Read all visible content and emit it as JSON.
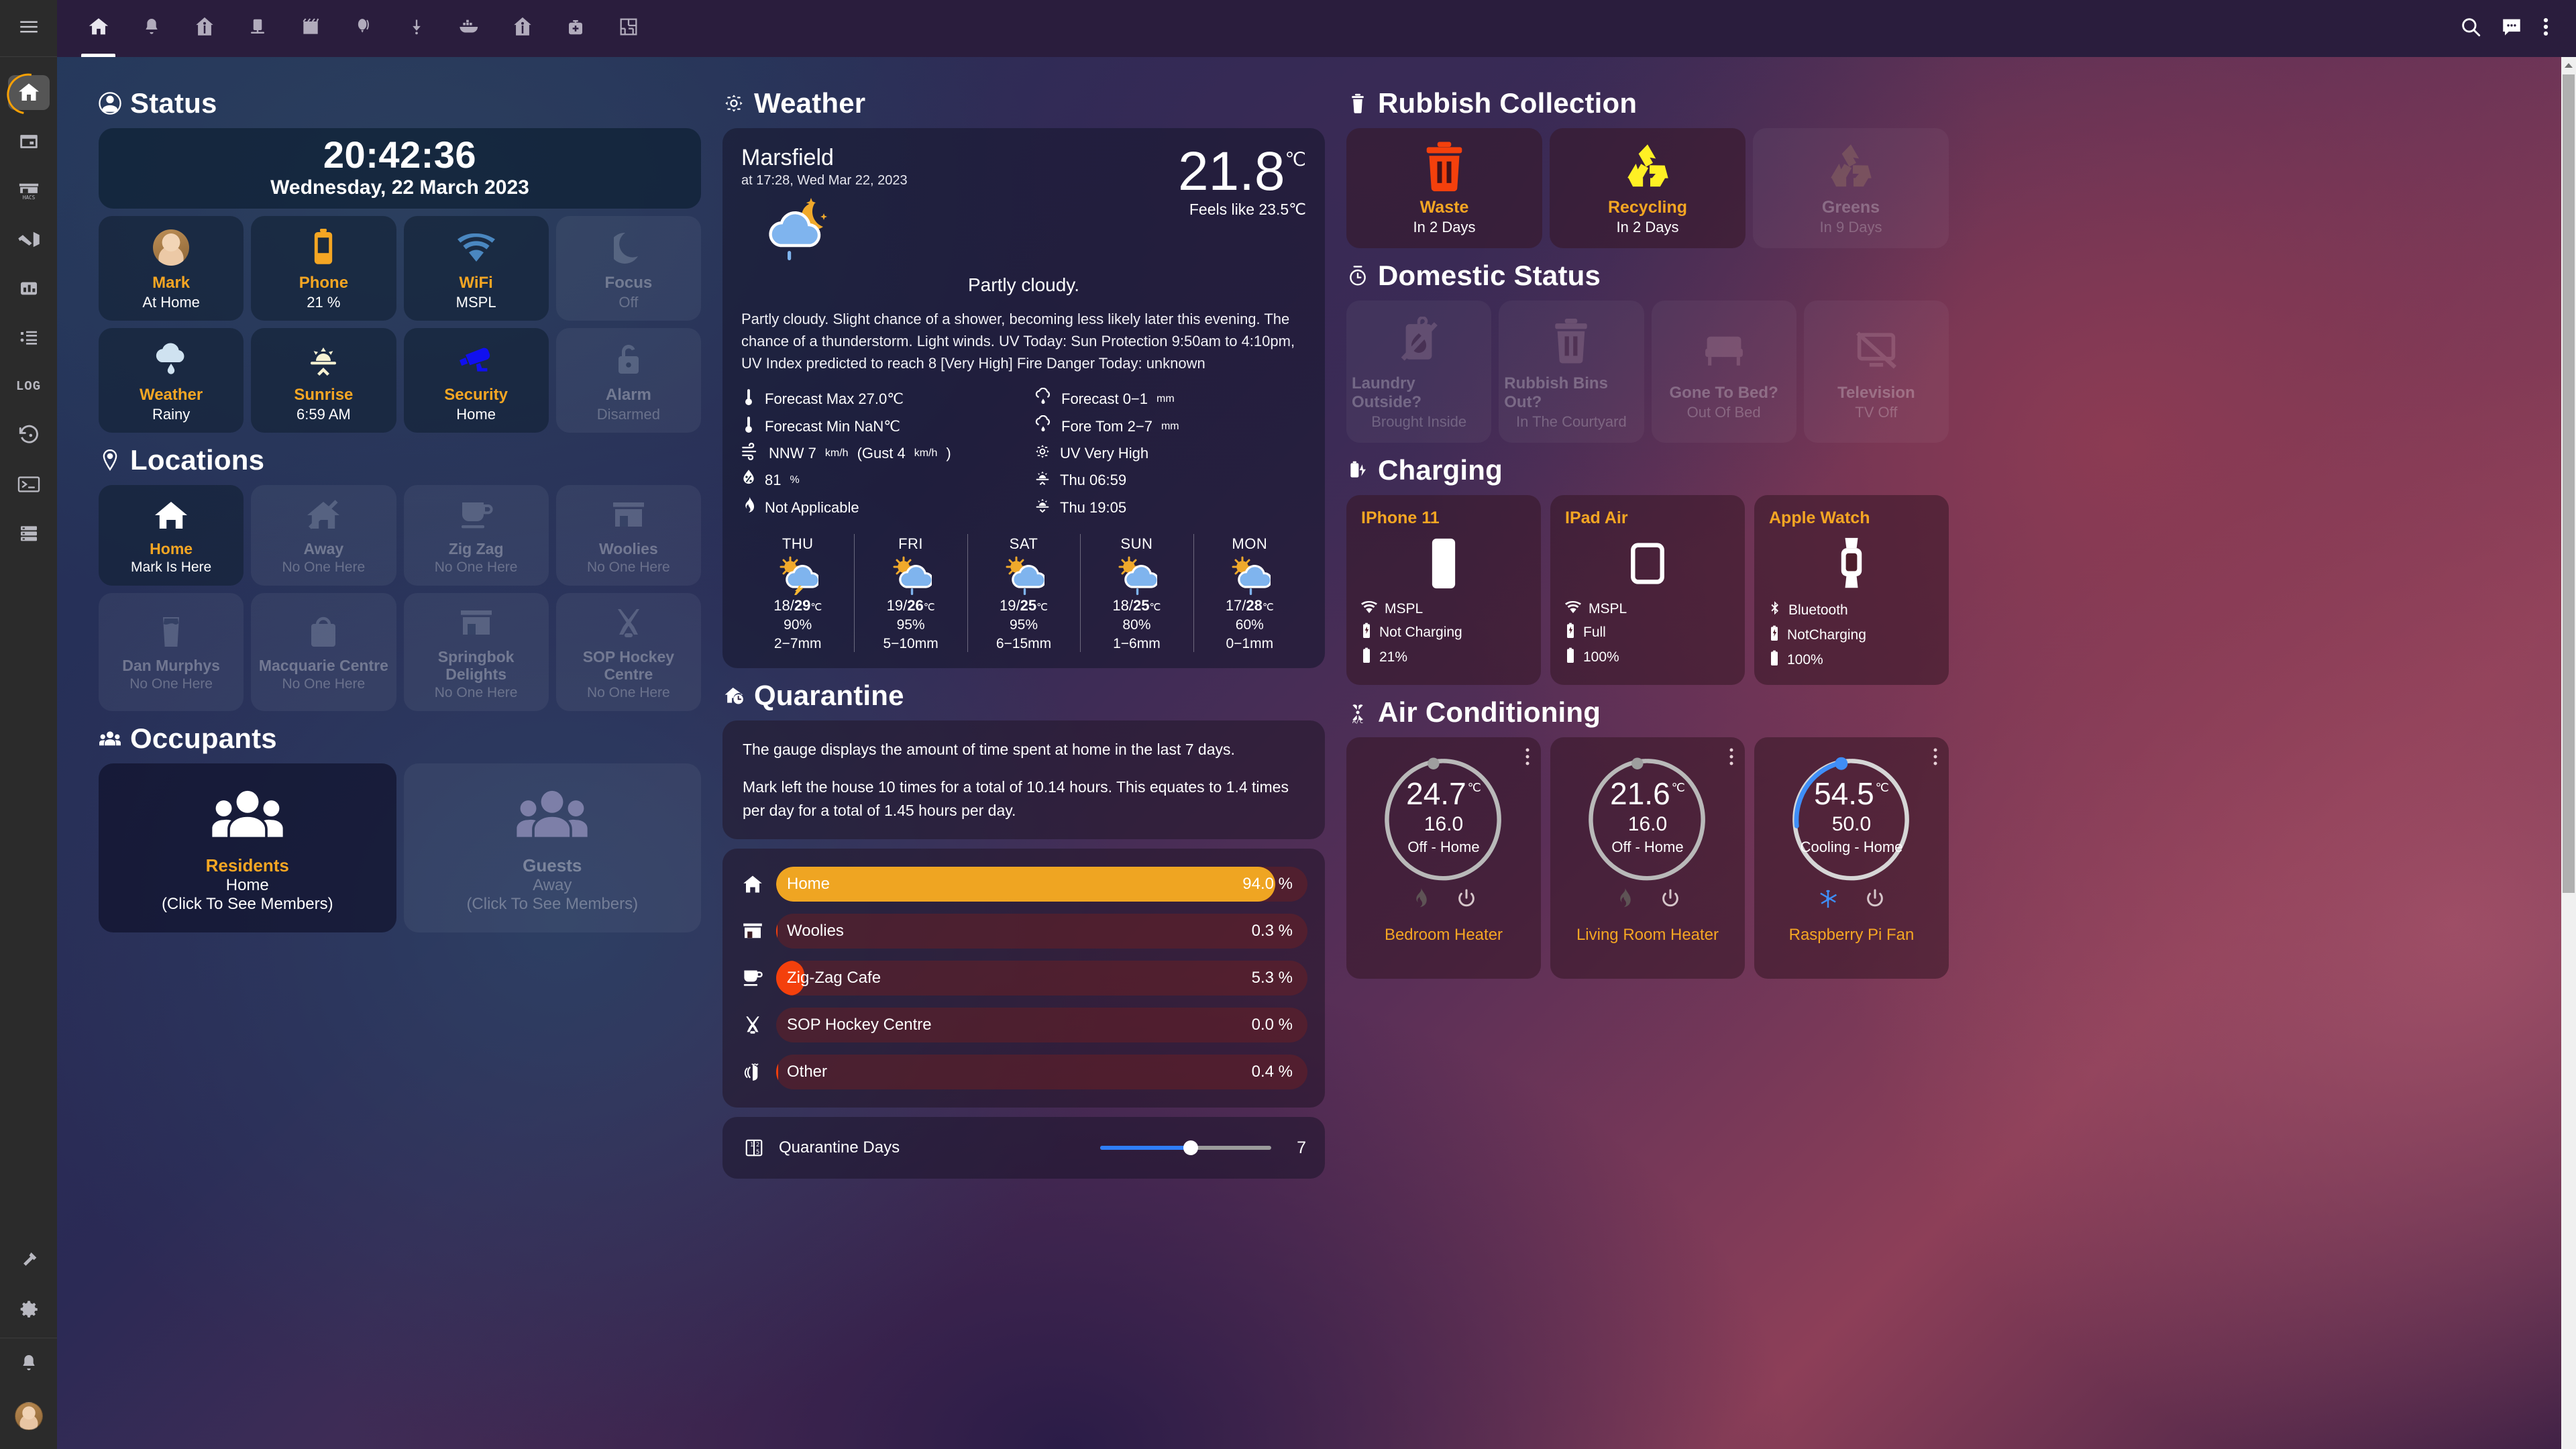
{
  "sidebar": {
    "menu_icon": "hamburger-icon",
    "items": [
      {
        "name": "home",
        "icon": "home-icon",
        "active": true
      },
      {
        "name": "calendar",
        "icon": "calendar-icon",
        "active": false
      },
      {
        "name": "hacs",
        "icon": "hacs-store-icon",
        "label": "HACS",
        "active": false
      },
      {
        "name": "vscode",
        "icon": "vscode-icon",
        "active": false
      },
      {
        "name": "statistics",
        "icon": "bar-chart-icon",
        "active": false
      },
      {
        "name": "list",
        "icon": "list-icon",
        "active": false
      },
      {
        "name": "log",
        "icon": "log-text-icon",
        "label": "LOG",
        "active": false
      },
      {
        "name": "history",
        "icon": "history-restore-icon",
        "active": false
      },
      {
        "name": "terminal",
        "icon": "terminal-icon",
        "active": false
      },
      {
        "name": "server",
        "icon": "server-rack-icon",
        "active": false
      }
    ],
    "bottom_items": [
      {
        "name": "developer-tools",
        "icon": "hammer-icon"
      },
      {
        "name": "settings",
        "icon": "gear-icon"
      },
      {
        "name": "notifications",
        "icon": "bell-icon"
      },
      {
        "name": "user-avatar",
        "icon": "avatar-icon"
      }
    ]
  },
  "topbar": {
    "tabs": [
      {
        "name": "home",
        "icon": "home-icon",
        "active": true
      },
      {
        "name": "alerts",
        "icon": "bell-icon",
        "active": false
      },
      {
        "name": "house-anchor",
        "icon": "home-anchor-icon",
        "active": false
      },
      {
        "name": "media",
        "icon": "media-player-icon",
        "active": false
      },
      {
        "name": "calendar-board",
        "icon": "notebook-icon",
        "active": false
      },
      {
        "name": "balloon",
        "icon": "balloon-icon",
        "active": false
      },
      {
        "name": "download",
        "icon": "download-icon",
        "active": false
      },
      {
        "name": "docker",
        "icon": "docker-icon",
        "active": false
      },
      {
        "name": "house-anchor-2",
        "icon": "home-anchor-icon",
        "active": false
      },
      {
        "name": "health",
        "icon": "medical-bag-icon",
        "active": false
      },
      {
        "name": "floorplan",
        "icon": "floorplan-icon",
        "active": false
      }
    ],
    "actions": [
      {
        "name": "search",
        "icon": "search-icon"
      },
      {
        "name": "assist",
        "icon": "chat-bubble-icon"
      },
      {
        "name": "overflow-menu",
        "icon": "dots-vertical-icon"
      }
    ]
  },
  "colors": {
    "accent": "#f5a623",
    "waste": "#f4400c",
    "recycling": "#fff024",
    "cooling": "#3f8ef7",
    "home_bar": "#efa522",
    "slider": "#2f7ef7"
  },
  "status": {
    "heading": "Status",
    "heading_icon": "account-icon",
    "clock": {
      "time": "20:42:36",
      "date": "Wednesday, 22 March 2023"
    },
    "tiles": [
      {
        "name": "Mark",
        "state": "At Home",
        "icon": "avatar-icon",
        "active": true
      },
      {
        "name": "Phone",
        "state": "21 %",
        "icon": "battery-icon",
        "active": true
      },
      {
        "name": "WiFi",
        "state": "MSPL",
        "icon": "wifi-icon",
        "active": true
      },
      {
        "name": "Focus",
        "state": "Off",
        "icon": "moon-icon",
        "active": false
      },
      {
        "name": "Weather",
        "state": "Rainy",
        "icon": "weather-rainy-icon",
        "active": true
      },
      {
        "name": "Sunrise",
        "state": "6:59 AM",
        "icon": "sunrise-icon",
        "active": true
      },
      {
        "name": "Security",
        "state": "Home",
        "icon": "cctv-icon",
        "active": true
      },
      {
        "name": "Alarm",
        "state": "Disarmed",
        "icon": "lock-open-icon",
        "active": false
      }
    ]
  },
  "locations": {
    "heading": "Locations",
    "heading_icon": "map-marker-icon",
    "tiles": [
      {
        "name": "Home",
        "state": "Mark Is Here",
        "icon": "home-icon",
        "active": true
      },
      {
        "name": "Away",
        "state": "No One Here",
        "icon": "home-off-icon",
        "active": false
      },
      {
        "name": "Zig Zag",
        "state": "No One Here",
        "icon": "coffee-cup-icon",
        "active": false
      },
      {
        "name": "Woolies",
        "state": "No One Here",
        "icon": "storefront-icon",
        "active": false
      },
      {
        "name": "Dan Murphys",
        "state": "No One Here",
        "icon": "glass-icon",
        "active": false
      },
      {
        "name": "Macquarie Centre",
        "state": "No One Here",
        "icon": "shopping-bag-icon",
        "active": false
      },
      {
        "name": "Springbok Delights",
        "state": "No One Here",
        "icon": "storefront-icon",
        "active": false
      },
      {
        "name": "SOP Hockey Centre",
        "state": "No One Here",
        "icon": "hockey-sticks-icon",
        "active": false
      }
    ]
  },
  "occupants": {
    "heading": "Occupants",
    "heading_icon": "people-group-icon",
    "tiles": [
      {
        "name": "Residents",
        "state": "Home",
        "hint": "(Click To See Members)",
        "icon": "people-group-icon",
        "active": true
      },
      {
        "name": "Guests",
        "state": "Away",
        "hint": "(Click To See Members)",
        "icon": "people-group-icon",
        "active": false
      }
    ]
  },
  "weather": {
    "heading": "Weather",
    "heading_icon": "sun-uv-icon",
    "location": "Marsfield",
    "observed_at": "at 17:28, Wed Mar 22, 2023",
    "icon": "night-partly-cloudy-rain-icon",
    "temperature": "21.8",
    "temperature_unit": "℃",
    "feels_like": "Feels like 23.5℃",
    "condition": "Partly cloudy.",
    "description": "Partly cloudy. Slight chance of a shower, becoming less likely later this evening. The chance of a thunderstorm. Light winds. UV Today: Sun Protection 9:50am to 4:10pm, UV Index predicted to reach 8 [Very High] Fire Danger Today: unknown",
    "stats_left": [
      {
        "icon": "thermometer-high-icon",
        "text": "Forecast Max 27.0℃"
      },
      {
        "icon": "thermometer-low-icon",
        "text": "Forecast Min NaN℃"
      },
      {
        "icon": "wind-icon",
        "text": "NNW 7",
        "unit": "km/h",
        "text2": " (Gust 4",
        "unit2": "km/h",
        "text3": ")"
      },
      {
        "icon": "humidity-icon",
        "text": "81",
        "unit": "%"
      },
      {
        "icon": "fire-icon",
        "text": "Not Applicable"
      }
    ],
    "stats_right": [
      {
        "icon": "rain-cloud-icon",
        "text": "Forecast 0−1",
        "unit": "mm"
      },
      {
        "icon": "rain-cloud-icon",
        "text": "Fore Tom 2−7",
        "unit": "mm"
      },
      {
        "icon": "uv-icon",
        "text": "UV Very High"
      },
      {
        "icon": "sunrise-icon",
        "text": "Thu 06:59"
      },
      {
        "icon": "sunset-icon",
        "text": "Thu 19:05"
      }
    ],
    "forecast": [
      {
        "dow": "THU",
        "icon": "storm-icon",
        "low": "18",
        "high": "29",
        "unit": "℃",
        "pop": "90%",
        "rain": "2−7",
        "rain_unit": "mm"
      },
      {
        "dow": "FRI",
        "icon": "partly-rainy-icon",
        "low": "19",
        "high": "26",
        "unit": "℃",
        "pop": "95%",
        "rain": "5−10",
        "rain_unit": "mm"
      },
      {
        "dow": "SAT",
        "icon": "partly-rainy-icon",
        "low": "19",
        "high": "25",
        "unit": "℃",
        "pop": "95%",
        "rain": "6−15",
        "rain_unit": "mm"
      },
      {
        "dow": "SUN",
        "icon": "partly-rainy-icon",
        "low": "18",
        "high": "25",
        "unit": "℃",
        "pop": "80%",
        "rain": "1−6",
        "rain_unit": "mm"
      },
      {
        "dow": "MON",
        "icon": "partly-rainy-icon",
        "low": "17",
        "high": "28",
        "unit": "℃",
        "pop": "60%",
        "rain": "0−1",
        "rain_unit": "mm"
      }
    ]
  },
  "quarantine": {
    "heading": "Quarantine",
    "heading_icon": "home-clock-icon",
    "info_line1": "The gauge displays the amount of time spent at home in the last 7 days.",
    "info_line2": "Mark left the house 10 times for a total of 10.14 hours. This equates to 1.4 times per day for a total of 1.45 hours per day.",
    "bars": [
      {
        "label": "Home",
        "pct": "94.0 %",
        "value": 94.0,
        "icon": "home-icon",
        "color": "#efa522",
        "highlight": true
      },
      {
        "label": "Woolies",
        "pct": "0.3 %",
        "value": 0.3,
        "icon": "storefront-icon",
        "color": "#f4400c",
        "highlight": false
      },
      {
        "label": "Zig-Zag Cafe",
        "pct": "5.3 %",
        "value": 5.3,
        "icon": "coffee-cup-icon",
        "color": "#f4400c",
        "highlight": false
      },
      {
        "label": "SOP Hockey Centre",
        "pct": "0.0 %",
        "value": 0.0,
        "icon": "hockey-sticks-icon",
        "color": "#f4400c",
        "highlight": false
      },
      {
        "label": "Other",
        "pct": "0.4 %",
        "value": 0.4,
        "icon": "smoke-icon",
        "color": "#f4400c",
        "highlight": false
      }
    ],
    "slider": {
      "label": "Quarantine Days",
      "value": "7",
      "icon": "numeric-icon",
      "percent": 53
    }
  },
  "rubbish": {
    "heading": "Rubbish Collection",
    "heading_icon": "trash-icon",
    "tiles": [
      {
        "name": "Waste",
        "state": "In 2 Days",
        "icon": "trash-can-icon",
        "color": "#f4400c",
        "active": true
      },
      {
        "name": "Recycling",
        "state": "In 2 Days",
        "icon": "recycle-icon",
        "color": "#fff024",
        "active": true
      },
      {
        "name": "Greens",
        "state": "In 9 Days",
        "icon": "recycle-icon",
        "color": "#8d7a46",
        "active": false
      }
    ]
  },
  "domestic": {
    "heading": "Domestic Status",
    "heading_icon": "timer-icon",
    "tiles": [
      {
        "name": "Laundry Outside?",
        "state": "Brought Inside",
        "icon": "hanger-off-icon",
        "active": false
      },
      {
        "name": "Rubbish Bins Out?",
        "state": "In The Courtyard",
        "icon": "trash-can-icon",
        "active": false
      },
      {
        "name": "Gone To Bed?",
        "state": "Out Of Bed",
        "icon": "bed-icon",
        "active": false
      },
      {
        "name": "Television",
        "state": "TV Off",
        "icon": "tv-off-icon",
        "active": false
      }
    ]
  },
  "charging": {
    "heading": "Charging",
    "heading_icon": "battery-charging-icon",
    "devices": [
      {
        "name": "IPhone 11",
        "device_icon": "cellphone-icon",
        "lines": [
          {
            "icon": "wifi-icon",
            "text": "MSPL"
          },
          {
            "icon": "battery-charging-icon",
            "text": "Not Charging"
          },
          {
            "icon": "battery-icon",
            "text": "21%"
          }
        ]
      },
      {
        "name": "IPad Air",
        "device_icon": "tablet-icon",
        "lines": [
          {
            "icon": "wifi-icon",
            "text": "MSPL"
          },
          {
            "icon": "battery-charging-icon",
            "text": "Full"
          },
          {
            "icon": "battery-icon",
            "text": "100%"
          }
        ]
      },
      {
        "name": "Apple Watch",
        "device_icon": "watch-icon",
        "lines": [
          {
            "icon": "bluetooth-icon",
            "text": "Bluetooth"
          },
          {
            "icon": "battery-charging-icon",
            "text": "NotCharging"
          },
          {
            "icon": "battery-icon",
            "text": "100%"
          }
        ]
      }
    ]
  },
  "aircon": {
    "heading": "Air Conditioning",
    "heading_icon": "ac-fan-icon",
    "units": [
      {
        "label": "Bedroom Heater",
        "current": "24.7",
        "unit": "℃",
        "setpoint": "16.0",
        "mode": "Off - Home",
        "dial_color": "#b9b9b9",
        "dial_progress": 4,
        "left_icon": "flame-icon",
        "left_active": false,
        "right_icon": "power-icon",
        "menu_icon": "dots-vertical-icon"
      },
      {
        "label": "Living Room Heater",
        "current": "21.6",
        "unit": "℃",
        "setpoint": "16.0",
        "mode": "Off - Home",
        "dial_color": "#b9b9b9",
        "dial_progress": 4,
        "left_icon": "flame-icon",
        "left_active": false,
        "right_icon": "power-icon",
        "menu_icon": "dots-vertical-icon"
      },
      {
        "label": "Raspberry Pi Fan",
        "current": "54.5",
        "unit": "℃",
        "setpoint": "50.0",
        "mode": "Cooling - Home",
        "dial_color": "#3f8ef7",
        "dial_progress": 4,
        "left_icon": "snowflake-icon",
        "left_active": true,
        "right_icon": "power-icon",
        "menu_icon": "dots-vertical-icon"
      }
    ]
  }
}
